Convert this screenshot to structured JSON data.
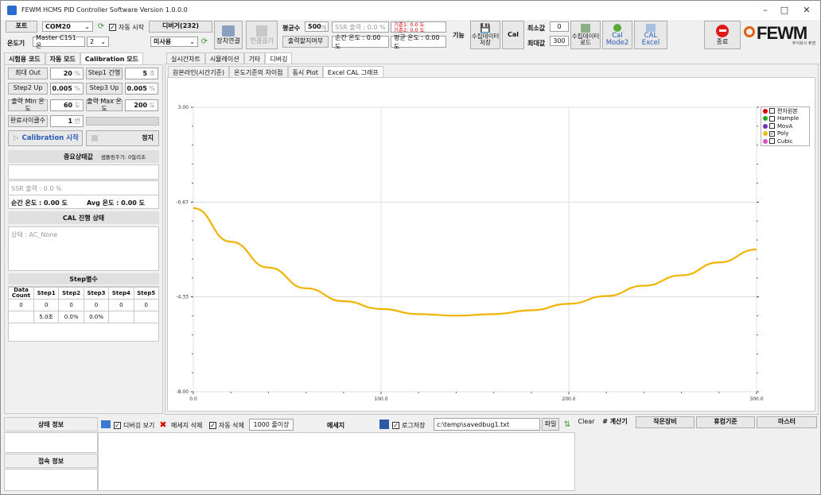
{
  "app": {
    "title": "FEWM HCMS PID Controller Software Version 1.0.0.0"
  },
  "toolbar": {
    "port_label": "포트",
    "port_value": "COM20",
    "auto_start_label": "자동 시작",
    "debug_btn": "디버거(232)",
    "thermometer_label": "온도기",
    "thermometer_value": "Master C1S1 온",
    "thermometer_num": "2",
    "mode_value": "미사용",
    "connect_btn": "장치연결",
    "disconnect_btn": "연결끊기",
    "avg_count_label": "평균수",
    "avg_count_value": "500",
    "avg_count_unit": "개",
    "ssr_output": "SSR 출력 : 0.0 %",
    "ref1": "기준1: 0.0 도",
    "ref2": "기준2: 0.0 도",
    "output_save_btn": "출력할지여부",
    "instant_temp": "순간 온도 : 0.00 도",
    "avg_temp": "평균 온도 : 0.00 도",
    "func_label": "기능",
    "collect_save_btn": "수집데이터 저장",
    "cal_btn": "Cal",
    "min_label": "최소값",
    "min_value": "0",
    "max_label": "최대값",
    "max_value": "300",
    "collect_load_btn": "수집데이터 로드",
    "cal_mode2_btn": "Cal Mode2",
    "cal_excel_btn": "CAL Excel",
    "exit_btn": "종료",
    "logo_text": "FEWM",
    "logo_sub": "주식회사 퓨엠"
  },
  "left": {
    "tabs": [
      "시험용 코드",
      "자동 모드",
      "Calibration 모드"
    ],
    "max_out_label": "최대 Out",
    "max_out_value": "20",
    "max_out_unit": "%",
    "step1_label": "Step1 간행",
    "step1_value": "5",
    "step1_unit": "초",
    "step2_label": "Step2 Up",
    "step2_value": "0.005",
    "step2_unit": "%",
    "step3_label": "Step3 Up",
    "step3_value": "0.005",
    "step3_unit": "%",
    "out_min_label": "출력 Min 온도",
    "out_min_value": "60",
    "out_min_unit": "도",
    "out_max_label": "출력 Max 온도",
    "out_max_value": "200",
    "out_max_unit": "도",
    "cycle_label": "완료사이클수",
    "cycle_value": "1",
    "cycle_unit": "번",
    "cal_start_btn": "Calibration 시작",
    "stop_btn": "정지",
    "main_status_hdr": "중요상태값",
    "collect_period": "샘플링주기: 0밀리초",
    "ssr_out": "SSR 출력 : 0.0 %",
    "instant_temp": "순간 온도 : 0.00 도",
    "avg_temp": "Avg 온도 : 0.00 도",
    "cal_status_hdr": "CAL 진행 상태",
    "status_text": "상태 : AC_None",
    "step_var_hdr": "Step별수",
    "step_table": {
      "headers": [
        "Data Count",
        "Step1",
        "Step2",
        "Step3",
        "Step4",
        "Step5"
      ],
      "rows": [
        [
          "0",
          "0",
          "0",
          "0",
          "0",
          "0"
        ],
        [
          "",
          "5.0초",
          "0.0%",
          "0.0%",
          "",
          ""
        ]
      ]
    }
  },
  "main": {
    "tabs_top": [
      "실시간차트",
      "시뮬레이션",
      "기타",
      "디버깅"
    ],
    "tabs_sub": [
      "원본라인(시간기준)",
      "온도기준의 차이점",
      "동시 Plot",
      "Excel CAL 그래프"
    ],
    "legend": [
      {
        "name": "편차원본",
        "color": "#e00000",
        "checked": false
      },
      {
        "name": "Hample",
        "color": "#22aa22",
        "checked": false
      },
      {
        "name": "MovA",
        "color": "#7030c0",
        "checked": false
      },
      {
        "name": "Poly",
        "color": "#e8c020",
        "checked": true
      },
      {
        "name": "Cubic",
        "color": "#e050c0",
        "checked": false
      }
    ]
  },
  "chart_data": {
    "type": "line",
    "xlim": [
      0,
      300
    ],
    "ylim": [
      -8,
      3
    ],
    "x_ticks": [
      "0.0",
      "100.0",
      "200.0",
      "300.0"
    ],
    "y_ticks": [
      "3.00",
      "-0.67",
      "-4.33",
      "-8.00"
    ],
    "series": [
      {
        "name": "Poly",
        "color": "#f0b400",
        "x": [
          0,
          20,
          40,
          60,
          80,
          100,
          120,
          140,
          160,
          180,
          200,
          220,
          240,
          260,
          280,
          300
        ],
        "y": [
          -0.9,
          -2.2,
          -3.2,
          -4.0,
          -4.5,
          -4.8,
          -5.0,
          -5.06,
          -5.0,
          -4.85,
          -4.6,
          -4.3,
          -3.9,
          -3.5,
          -3.0,
          -2.5
        ]
      }
    ]
  },
  "bottom": {
    "status_info": "상태 정보",
    "debug_view": "디버깅 보기",
    "delete_msg": "메세지 삭제",
    "auto_delete": "자동 삭제",
    "auto_delete_count": "1000 줄이상",
    "message": "메세지",
    "log_save": "로그저장",
    "log_path": "c:\\temp\\savedbug1.txt",
    "file_btn": "파일",
    "conn_info": "접속 정보",
    "clear_btn": "Clear",
    "calc_btn": "# 계산기",
    "small_device": "작은장비",
    "screen_std": "휴컴기준",
    "master": "마스터"
  }
}
